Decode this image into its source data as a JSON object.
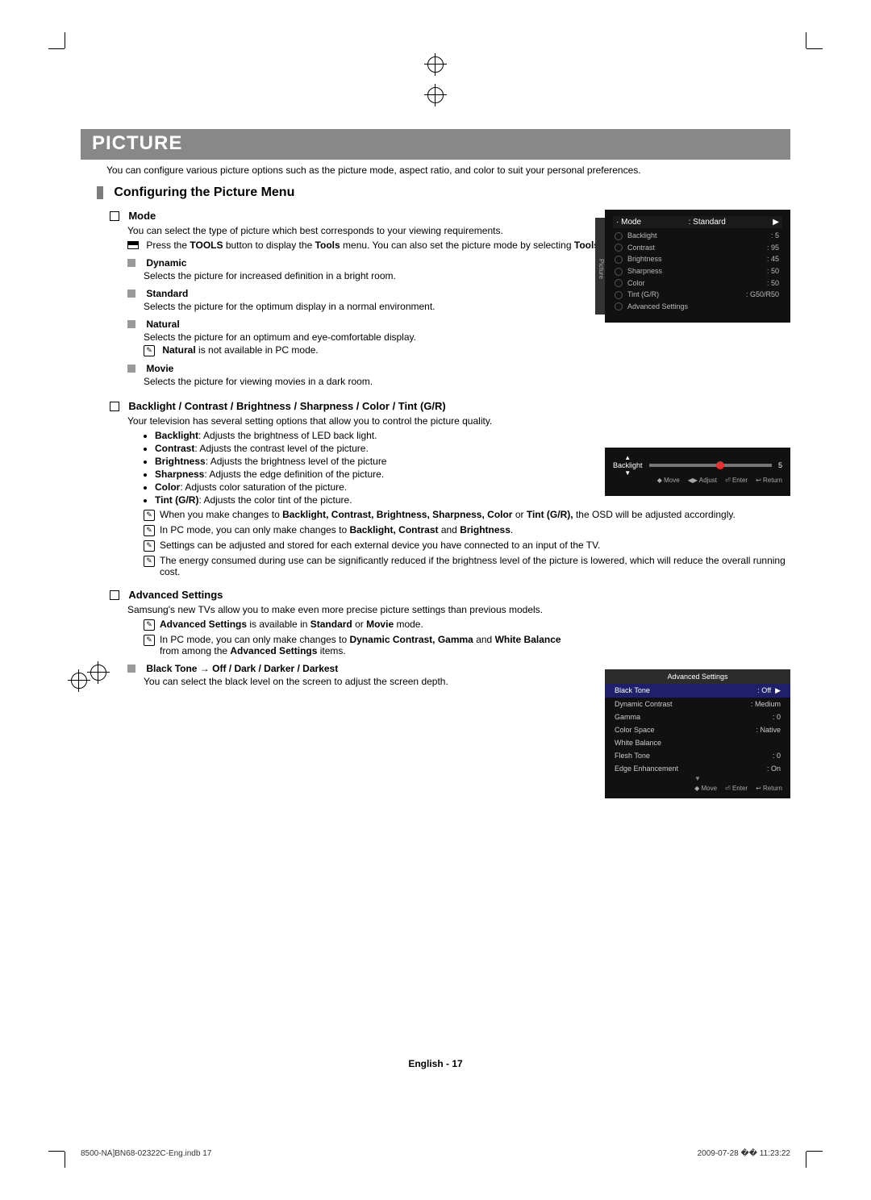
{
  "header": {
    "title": "PICTURE"
  },
  "intro": "You can configure various picture options such as the picture mode, aspect ratio, and color to suit your personal preferences.",
  "h2": "Configuring the Picture Menu",
  "mode": {
    "title": "Mode",
    "desc": "You can select the type of picture which best corresponds to your viewing requirements.",
    "tools_pre": "Press the ",
    "tools_b1": "TOOLS",
    "tools_mid": " button to display the ",
    "tools_b2": "Tools",
    "tools_post": " menu. You can also set the picture mode by selecting ",
    "tools_b3": "Tools → Picture Mode",
    "tools_end": ".",
    "dynamic_t": "Dynamic",
    "dynamic_d": "Selects the picture for increased definition in a bright room.",
    "standard_t": "Standard",
    "standard_d": "Selects the picture for the optimum display in a normal environment.",
    "natural_t": "Natural",
    "natural_d": "Selects the picture for an optimum and eye-comfortable display.",
    "natural_note_b": "Natural",
    "natural_note_t": " is not available in PC mode.",
    "movie_t": "Movie",
    "movie_d": "Selects the picture for viewing movies in a dark room."
  },
  "bccs": {
    "title": "Backlight / Contrast / Brightness / Sharpness / Color / Tint (G/R)",
    "desc": "Your television has several setting options that allow you to control the picture quality.",
    "items": [
      {
        "b": "Backlight",
        "t": ": Adjusts the brightness of LED back light."
      },
      {
        "b": "Contrast",
        "t": ": Adjusts the contrast level of the picture."
      },
      {
        "b": "Brightness",
        "t": ": Adjusts the brightness level of the picture"
      },
      {
        "b": "Sharpness",
        "t": ": Adjusts the edge definition of the picture."
      },
      {
        "b": "Color",
        "t": ": Adjusts color saturation of the picture."
      },
      {
        "b": "Tint (G/R)",
        "t": ": Adjusts the color tint of the picture."
      }
    ],
    "n1_pre": "When you make changes to ",
    "n1_b": "Backlight, Contrast, Brightness, Sharpness, Color",
    "n1_mid": " or ",
    "n1_b2": "Tint (G/R),",
    "n1_post": " the OSD will be adjusted accordingly.",
    "n2_pre": "In PC mode, you can only make changes to ",
    "n2_b": "Backlight, Contrast",
    "n2_mid": " and ",
    "n2_b2": "Brightness",
    "n2_end": ".",
    "n3": "Settings can be adjusted and stored for each external device you have connected to an input of the TV.",
    "n4": "The energy consumed during use can be significantly reduced if the brightness level of the picture is lowered, which will reduce the overall running cost."
  },
  "adv": {
    "title": "Advanced Settings",
    "desc": "Samsung's new TVs allow you to make even more precise picture settings than previous models.",
    "n1_b": "Advanced Settings",
    "n1_mid": " is available in ",
    "n1_b2": "Standard",
    "n1_or": " or ",
    "n1_b3": "Movie",
    "n1_end": " mode.",
    "n2_pre": "In PC mode, you can only make changes to ",
    "n2_b": "Dynamic Contrast, Gamma",
    "n2_mid": " and ",
    "n2_b2": "White Balance",
    "n2_mid2": " from among the ",
    "n2_b3": "Advanced Settings",
    "n2_end": " items.",
    "bt_t": "Black Tone → Off / Dark / Darker / Darkest",
    "bt_d": "You can select the black level on the screen to adjust the screen depth."
  },
  "osd1": {
    "tab": "Picture",
    "head_l": "· Mode",
    "head_r": ": Standard",
    "rows": [
      {
        "l": "Backlight",
        "r": ": 5"
      },
      {
        "l": "Contrast",
        "r": ": 95"
      },
      {
        "l": "Brightness",
        "r": ": 45"
      },
      {
        "l": "Sharpness",
        "r": ": 50"
      },
      {
        "l": "Color",
        "r": ": 50"
      },
      {
        "l": "Tint (G/R)",
        "r": ": G50/R50"
      },
      {
        "l": "Advanced Settings",
        "r": ""
      }
    ]
  },
  "osd2": {
    "label": "Backlight",
    "val": "5",
    "foot": [
      "◆ Move",
      "◀▶ Adjust",
      "⏎ Enter",
      "↩ Return"
    ]
  },
  "osd3": {
    "title": "Advanced Settings",
    "rows": [
      {
        "l": "Black Tone",
        "r": ": Off",
        "hi": true
      },
      {
        "l": "Dynamic Contrast",
        "r": ": Medium"
      },
      {
        "l": "Gamma",
        "r": ": 0"
      },
      {
        "l": "Color Space",
        "r": ": Native"
      },
      {
        "l": "White Balance",
        "r": ""
      },
      {
        "l": "Flesh Tone",
        "r": ": 0"
      },
      {
        "l": "Edge Enhancement",
        "r": ": On"
      }
    ],
    "foot": [
      "◆ Move",
      "⏎ Enter",
      "↩ Return"
    ]
  },
  "footer": {
    "page": "English - 17",
    "file": "8500-NA]BN68-02322C-Eng.indb   17",
    "stamp": "2009-07-28   �� 11:23:22"
  }
}
